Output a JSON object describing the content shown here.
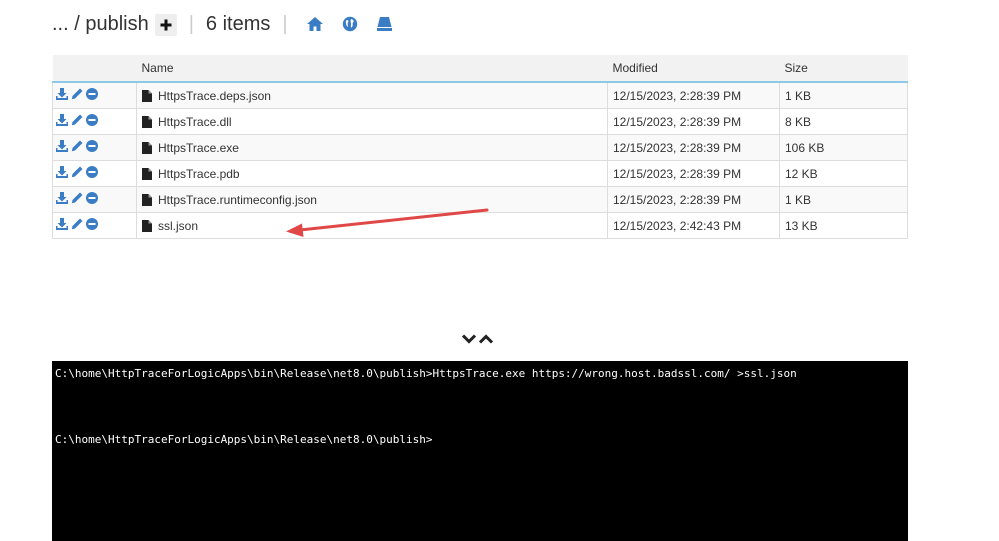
{
  "breadcrumb": {
    "path": "... / publish",
    "item_count": "6 items"
  },
  "icons": {
    "add": "plus-icon",
    "home": "home-icon",
    "globe": "globe-icon",
    "drive": "drive-icon",
    "download": "download-icon",
    "edit": "pencil-icon",
    "delete": "minus-circle-icon",
    "file": "file-icon"
  },
  "colors": {
    "accent": "#3a7dc5",
    "header_border": "#8ec8e8",
    "arrow": "#e04848",
    "console_bg": "#000000"
  },
  "table": {
    "columns": [
      "",
      "Name",
      "Modified",
      "Size"
    ],
    "rows": [
      {
        "name": "HttpsTrace.deps.json",
        "modified": "12/15/2023, 2:28:39 PM",
        "size": "1 KB"
      },
      {
        "name": "HttpsTrace.dll",
        "modified": "12/15/2023, 2:28:39 PM",
        "size": "8 KB"
      },
      {
        "name": "HttpsTrace.exe",
        "modified": "12/15/2023, 2:28:39 PM",
        "size": "106 KB"
      },
      {
        "name": "HttpsTrace.pdb",
        "modified": "12/15/2023, 2:28:39 PM",
        "size": "12 KB"
      },
      {
        "name": "HttpsTrace.runtimeconfig.json",
        "modified": "12/15/2023, 2:28:39 PM",
        "size": "1 KB"
      },
      {
        "name": "ssl.json",
        "modified": "12/15/2023, 2:42:43 PM",
        "size": "13 KB"
      }
    ]
  },
  "console": {
    "lines": [
      "C:\\home\\HttpTraceForLogicApps\\bin\\Release\\net8.0\\publish>HttpsTrace.exe https://wrong.host.badssl.com/ >ssl.json",
      "C:\\home\\HttpTraceForLogicApps\\bin\\Release\\net8.0\\publish>"
    ]
  }
}
